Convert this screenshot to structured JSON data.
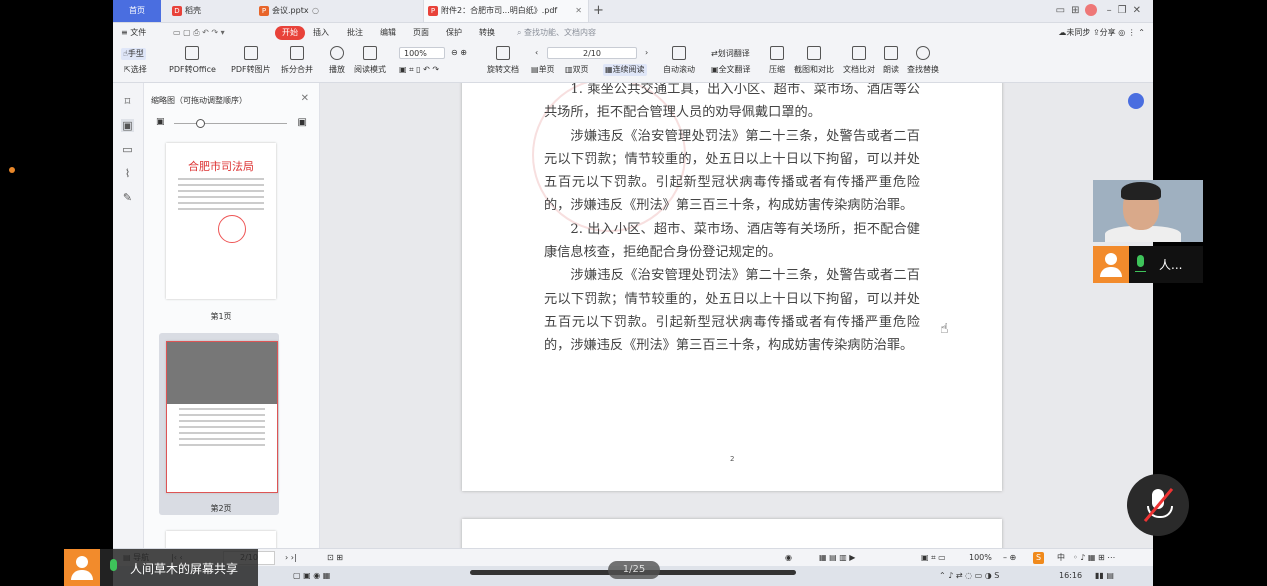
{
  "tabs": {
    "home": "首页",
    "t1": "稻壳",
    "t2": "会议.pptx",
    "t3": "附件2：合肥市司...明白纸》.pdf"
  },
  "menubar": {
    "file": "≡ 文件",
    "start": "开始",
    "insert": "插入",
    "annotate": "批注",
    "edit": "编辑",
    "page": "页面",
    "protect": "保护",
    "convert": "转换",
    "search_placeholder": "查找功能、文档内容",
    "not_synced": "未同步",
    "share": "分享"
  },
  "toolbar": {
    "hand": "手型",
    "select": "选择",
    "pdf_to_office": "PDF转Office",
    "pdf_to_image": "PDF转图片",
    "split_merge": "拆分合并",
    "play": "播放",
    "read_mode": "阅读模式",
    "zoom": "100%",
    "page_indicator": "2/10",
    "rotate": "旋转文档",
    "single": "单页",
    "double": "双页",
    "continuous": "连续阅读",
    "auto_scroll": "自动滚动",
    "word_translate": "划词翻译",
    "full_translate": "全文翻译",
    "compress": "压缩",
    "screenshot_compare": "截图和对比",
    "text_compare": "文档比对",
    "read_aloud": "朗读",
    "find_replace": "查找替换"
  },
  "thumbs": {
    "title": "缩略图（可拖动调整顺序）",
    "p1_heading": "合肥市司法局",
    "p1_label": "第1页",
    "p2_label": "第2页"
  },
  "document": {
    "paragraphs": [
      "1. 乘坐公共交通工具，出入小区、超市、菜市场、酒店等公共场所，拒不配合管理人员的劝导佩戴口罩的。",
      "涉嫌违反《治安管理处罚法》第二十三条，处警告或者二百元以下罚款；情节较重的，处五日以上十日以下拘留，可以并处五百元以下罚款。引起新型冠状病毒传播或者有传播严重危险的，涉嫌违反《刑法》第三百三十条，构成妨害传染病防治罪。",
      "2. 出入小区、超市、菜市场、酒店等有关场所，拒不配合健康信息核查，拒绝配合身份登记规定的。",
      "涉嫌违反《治安管理处罚法》第二十三条，处警告或者二百元以下罚款；情节较重的，处五日以上十日以下拘留，可以并处五百元以下罚款。引起新型冠状病毒传播或者有传播严重危险的，涉嫌违反《刑法》第三百三十条，构成妨害传染病防治罪。"
    ],
    "page_number": "2"
  },
  "status": {
    "nav": "导航",
    "page": "2/10",
    "zoom": "100%",
    "ime": "中"
  },
  "taskbar": {
    "time": "16:16"
  },
  "meeting": {
    "participant_name": "人...",
    "sharer": "人间草木的屏幕共享",
    "pager": "1/25"
  }
}
